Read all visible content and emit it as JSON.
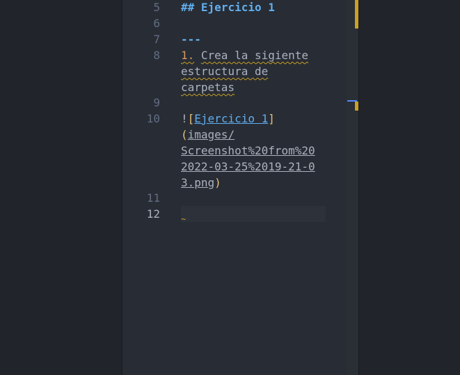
{
  "editor": {
    "lines": [
      {
        "num": "5",
        "heading_marker": "##",
        "heading_text": "Ejercicio 1"
      },
      {
        "num": "6"
      },
      {
        "num": "7",
        "rule": "---"
      },
      {
        "num": "8",
        "list_num": "1.",
        "wrap1": "Crea la sigiente",
        "wrap2": "estructura de",
        "wrap3": "carpetas"
      },
      {
        "num": "9"
      },
      {
        "num": "10",
        "bang": "!",
        "open_bracket": "[",
        "alt": "Ejercicio 1",
        "close_bracket": "]",
        "open_paren": "(",
        "url1": "images/",
        "url2": "Screenshot%20from%20",
        "url3": "2022-03-25%2019-21-0",
        "url4": "3.png",
        "close_paren": ")"
      },
      {
        "num": "11"
      },
      {
        "num": "12",
        "trail": "~"
      }
    ]
  },
  "colors": {
    "background": "#21252b",
    "editor_bg": "#282c34",
    "accent_blue": "#61afef",
    "warning_yellow": "#c8a125",
    "number_orange": "#d19a66",
    "bracket_yellow": "#e5c07b"
  }
}
